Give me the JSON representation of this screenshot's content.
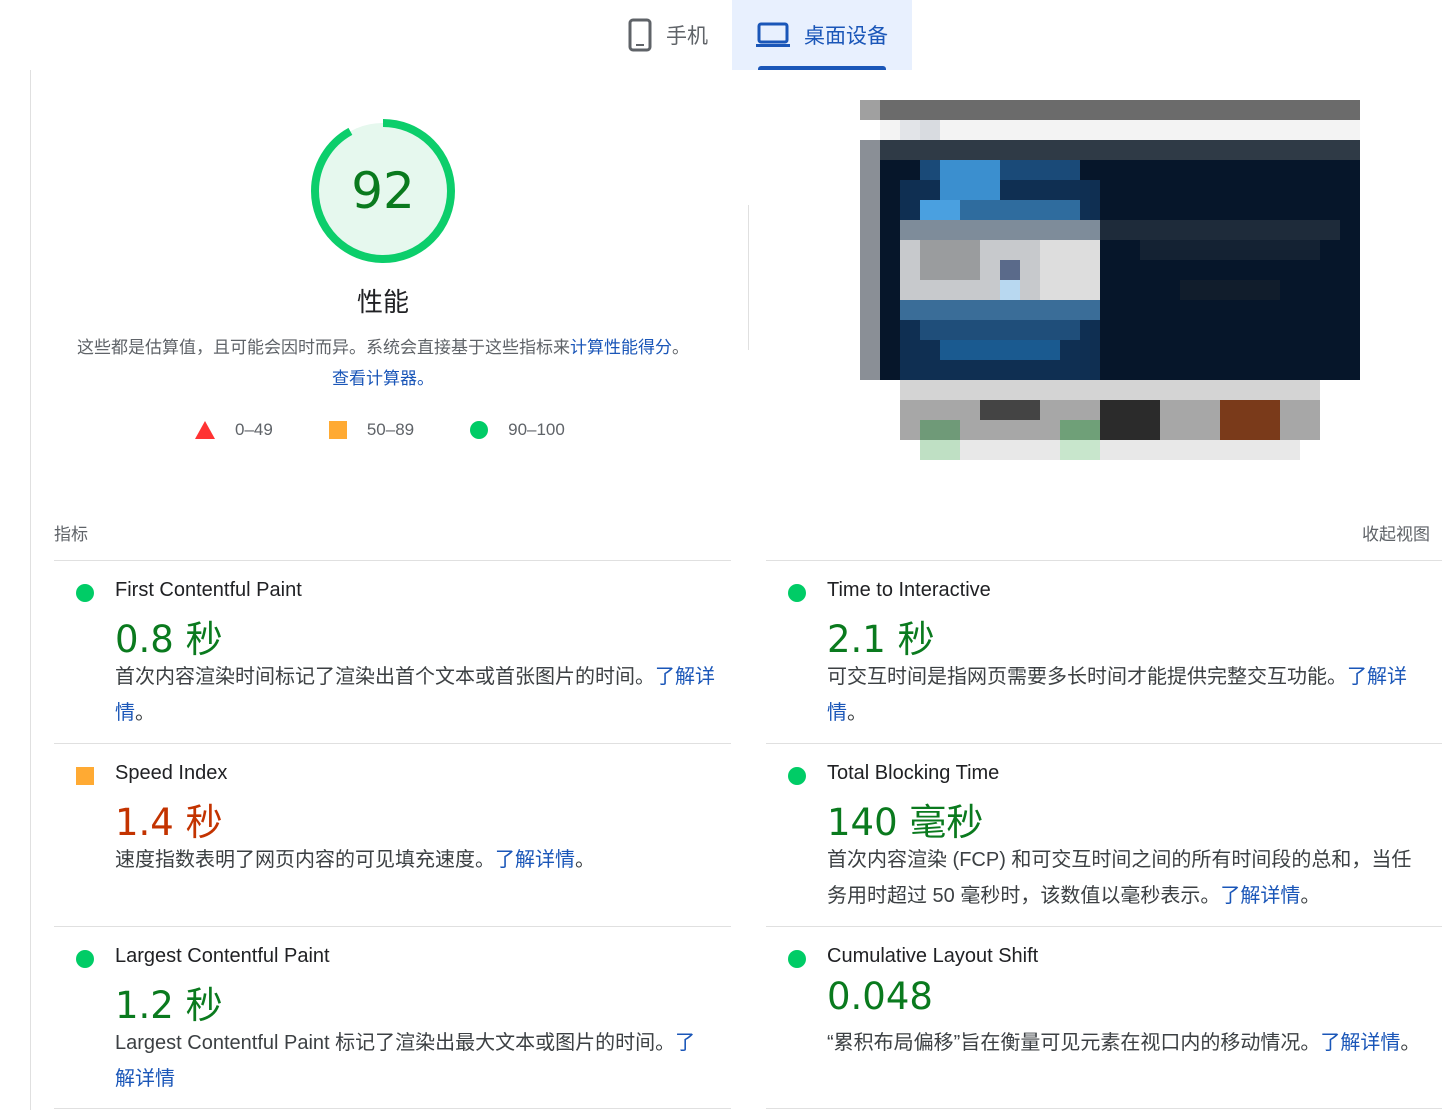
{
  "tabs": [
    {
      "label": "手机",
      "icon": "phone-icon",
      "active": false
    },
    {
      "label": "桌面设备",
      "icon": "laptop-icon",
      "active": true
    }
  ],
  "performance": {
    "score": "92",
    "score_value": 92,
    "title": "性能",
    "description_prefix": "这些都是估算值，且可能会因时而异。系统会直接基于这些指标来",
    "description_link": "计算性能得分",
    "description_mid": "。",
    "calculator_link": "查看计算器",
    "description_end": "。"
  },
  "legend": [
    {
      "range": "0–49",
      "shape": "triangle",
      "color": "#ff3333"
    },
    {
      "range": "50–89",
      "shape": "square",
      "color": "#ffaa33"
    },
    {
      "range": "90–100",
      "shape": "circle",
      "color": "#00cc66"
    }
  ],
  "metrics_header": "指标",
  "collapse_label": "收起视图",
  "learn_more": "了解详情",
  "metrics": [
    {
      "title": "First Contentful Paint",
      "value": "0.8 秒",
      "status": "good",
      "desc": "首次内容渲染时间标记了渲染出首个文本或首张图片的时间。",
      "link": "了解详情",
      "end": "。"
    },
    {
      "title": "Time to Interactive",
      "value": "2.1 秒",
      "status": "good",
      "desc": "可交互时间是指网页需要多长时间才能提供完整交互功能。",
      "link": "了解详情",
      "end": "。"
    },
    {
      "title": "Speed Index",
      "value": "1.4 秒",
      "status": "average",
      "desc": "速度指数表明了网页内容的可见填充速度。",
      "link": "了解详情",
      "end": "。"
    },
    {
      "title": "Total Blocking Time",
      "value": "140 毫秒",
      "status": "good",
      "desc": "首次内容渲染 (FCP) 和可交互时间之间的所有时间段的总和，当任务用时超过 50 毫秒时，该数值以毫秒表示。",
      "link": "了解详情",
      "end": "。"
    },
    {
      "title": "Largest Contentful Paint",
      "value": "1.2 秒",
      "status": "good",
      "desc": "Largest Contentful Paint 标记了渲染出最大文本或图片的时间。",
      "link": "了解详情",
      "end": ""
    },
    {
      "title": "Cumulative Layout Shift",
      "value": "0.048",
      "status": "good",
      "desc": "“累积布局偏移”旨在衡量可见元素在视口内的移动情况。",
      "link": "了解详情",
      "end": "。"
    }
  ],
  "colors": {
    "good": "#0a7a1e",
    "average": "#c33300",
    "accent": "#1a56b8",
    "gauge_ring": "#0cce6b",
    "gauge_fill": "#e6f8ee"
  }
}
